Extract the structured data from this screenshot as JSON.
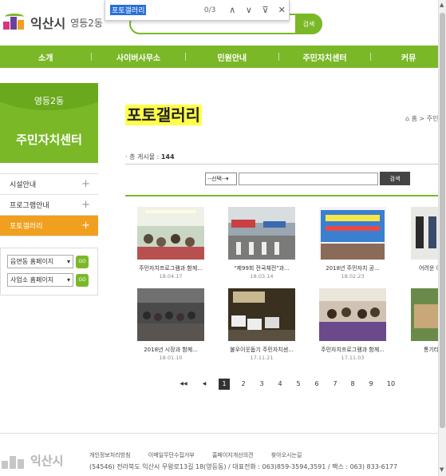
{
  "header": {
    "logo_text": "익산시",
    "logo_sub": "영등2동",
    "search_button": "검색"
  },
  "findbar": {
    "query": "포토갤러리",
    "count": "0/3",
    "prev": "∧",
    "next": "∨",
    "filter": "⊽",
    "close": "✕"
  },
  "nav": {
    "items": [
      "소개",
      "사이버사무소",
      "민원안내",
      "주민자치센터",
      "커뮤"
    ]
  },
  "sidebar": {
    "dong": "영등2동",
    "title": "주민자치센터",
    "items": [
      {
        "label": "시설안내",
        "icon": "+"
      },
      {
        "label": "프로그램안내",
        "icon": "+"
      },
      {
        "label": "포토갤러리",
        "icon": "+"
      }
    ],
    "select1": "읍면동 홈페이지",
    "select2": "사업소 홈페이지",
    "go": "GO"
  },
  "content": {
    "title": "포토갤러리",
    "breadcrumb_home": "홈",
    "breadcrumb_sep": ">",
    "breadcrumb_next": "주민",
    "total_label": "· 총 게시물 : ",
    "total_value": "144",
    "filter_select": "--선택--",
    "filter_button": "검색"
  },
  "gallery": [
    {
      "caption": "주민자치프로그램과 함께...",
      "date": "18.04.17"
    },
    {
      "caption": "\"제99회 전국체전\"과...",
      "date": "18.03.14"
    },
    {
      "caption": "2018년 주민자치 공...",
      "date": "18.02.23"
    },
    {
      "caption": "어려운 이",
      "date": ""
    },
    {
      "caption": "2018년 시장과 함께...",
      "date": "18.01.10"
    },
    {
      "caption": "불우이웃돕기 주민자치센...",
      "date": "17.11.21"
    },
    {
      "caption": "주민자치프로그램과 함께...",
      "date": "17.11.03"
    },
    {
      "caption": "통기타",
      "date": ""
    }
  ],
  "pager": {
    "first": "◀◀",
    "prev": "◀",
    "pages": [
      "1",
      "2",
      "3",
      "4",
      "5",
      "6",
      "7",
      "8",
      "9",
      "10"
    ],
    "current": "1"
  },
  "footer": {
    "logo_text": "익산시",
    "links": [
      "개인정보처리방침",
      "이메일무단수집거부",
      "홈페이지개선의견",
      "찾아오시는길"
    ],
    "address": "(54546) 전라북도 익산시 무왕로13길 18(영등동) / 대표전화 : 063)859-3594,3591 / 팩스 : 063) 833-6177"
  },
  "colors": {
    "brand_green": "#7ab828",
    "active_orange": "#f0a01e",
    "title_highlight": "#ffff4a"
  }
}
